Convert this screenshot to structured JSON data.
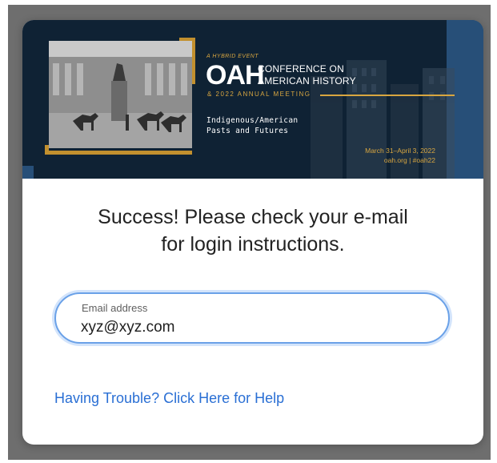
{
  "banner": {
    "tagline": "A HYBRID EVENT",
    "logo_text": "OAH",
    "title_line1": "CONFERENCE ON",
    "title_line2": "AMERICAN HISTORY",
    "subtitle": "& 2022 ANNUAL MEETING",
    "theme_line1": "Indigenous/American",
    "theme_line2": "Pasts and Futures",
    "dates": "March 31–April 3, 2022",
    "site_hashtag": "oah.org | #oah22",
    "colors": {
      "navy": "#0f2234",
      "gold": "#c2902e",
      "blue": "#274f78"
    }
  },
  "message": {
    "line1": "Success! Please check your e-mail",
    "line2": "for login instructions."
  },
  "email": {
    "label": "Email address",
    "value": "xyz@xyz.com",
    "accent": "#6aa1e8"
  },
  "help": {
    "link_text": "Having Trouble? Click Here for Help",
    "color": "#2a6fd4"
  }
}
